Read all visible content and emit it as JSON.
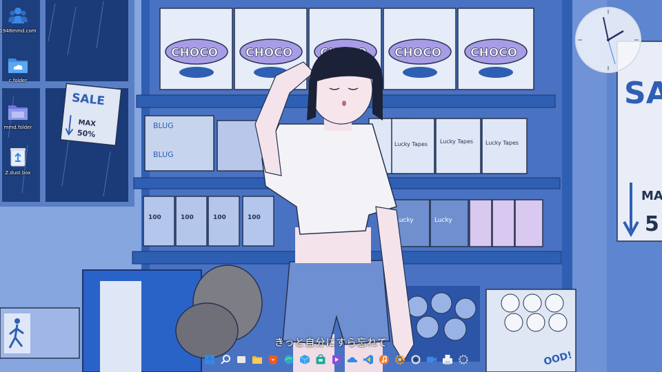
{
  "desktop": {
    "icons": [
      {
        "label": "1948mmd.com",
        "icon": "user-group-icon"
      },
      {
        "label": "c.folder",
        "icon": "cloud-folder-icon"
      },
      {
        "label": "mmd.folder",
        "icon": "folder-icon"
      },
      {
        "label": "Z.dust.box",
        "icon": "recycle-bin-icon"
      }
    ]
  },
  "wallpaper": {
    "lyric": "きっと自分にすら忘れて",
    "signs": {
      "sale_small": "SALE",
      "max_small": "MAX",
      "pct_small": "50%",
      "sale_large": "SA",
      "max_large": "MA",
      "pct_large": "5"
    },
    "choco_label": "CHOCO",
    "blug_label": "BLUG",
    "lucky_tapes_label": "Lucky Tapes",
    "lucky_label": "Lucky",
    "milk_label": "100",
    "box_label": "OOD!"
  },
  "taskbar": {
    "items": [
      {
        "icon": "windows-start-icon",
        "color": "#2f8be6"
      },
      {
        "icon": "search-icon",
        "color": "#f2f2f2"
      },
      {
        "icon": "task-view-icon",
        "color": "#e8e8e8"
      },
      {
        "icon": "file-explorer-icon",
        "color": "#f2b530"
      },
      {
        "icon": "brave-browser-icon",
        "color": "#f05a23"
      },
      {
        "icon": "edge-browser-icon",
        "color": "#2aa7d9"
      },
      {
        "icon": "cube-app-icon",
        "color": "#3aa0f0"
      },
      {
        "icon": "store-app-icon",
        "color": "#1fa89a"
      },
      {
        "icon": "media-player-icon",
        "color": "#8a4fd8"
      },
      {
        "icon": "onedrive-icon",
        "color": "#2f8be6"
      },
      {
        "icon": "vscode-icon",
        "color": "#f2c230"
      },
      {
        "icon": "music-app-icon",
        "color": "#f07830"
      },
      {
        "icon": "gear-app-icon",
        "color": "#e89a30"
      },
      {
        "icon": "circle-app-icon",
        "color": "#e8e8e8"
      },
      {
        "icon": "video-app-icon",
        "color": "#3a8ae6"
      },
      {
        "icon": "printer-app-icon",
        "color": "#f2f2f2"
      },
      {
        "icon": "settings-icon",
        "color": "#cfd6e0"
      }
    ]
  },
  "colors": {
    "accent": "#2f8be6",
    "shelf": "#2e5fb3",
    "wall": "#8aa8e0"
  }
}
